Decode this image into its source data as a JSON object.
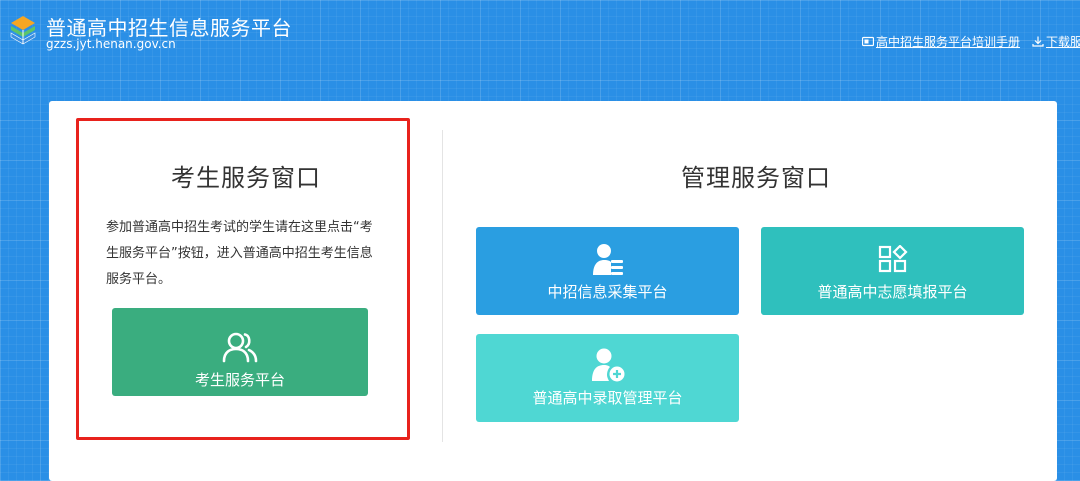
{
  "header": {
    "title": "普通高中招生信息服务平台",
    "domain": "gzzs.jyt.henan.gov.cn",
    "links": {
      "manual": "高中招生服务平台培训手册",
      "download": "下载服"
    }
  },
  "student_window": {
    "title": "考生服务窗口",
    "description": "参加普通高中招生考试的学生请在这里点击“考生服务平台”按钮，进入普通高中招生考生信息服务平台。",
    "button_label": "考生服务平台"
  },
  "management_window": {
    "title": "管理服务窗口",
    "tiles": [
      {
        "label": "中招信息采集平台"
      },
      {
        "label": "普通高中志愿填报平台"
      },
      {
        "label": "普通高中录取管理平台"
      }
    ]
  },
  "colors": {
    "background": "#2a8fe6",
    "highlight_border": "#e8221c",
    "student_button": "#3aad7f",
    "tile_collect": "#2a9ee1",
    "tile_volunteer": "#2fc0bd",
    "tile_admit": "#4fd7d3"
  },
  "icons": {
    "logo": "book-stack-logo",
    "manual_link": "manual-icon",
    "download_link": "download-icon",
    "student_button": "users-icon",
    "tile_collect": "user-list-icon",
    "tile_volunteer": "apps-grid-icon",
    "tile_admit": "user-add-icon"
  }
}
